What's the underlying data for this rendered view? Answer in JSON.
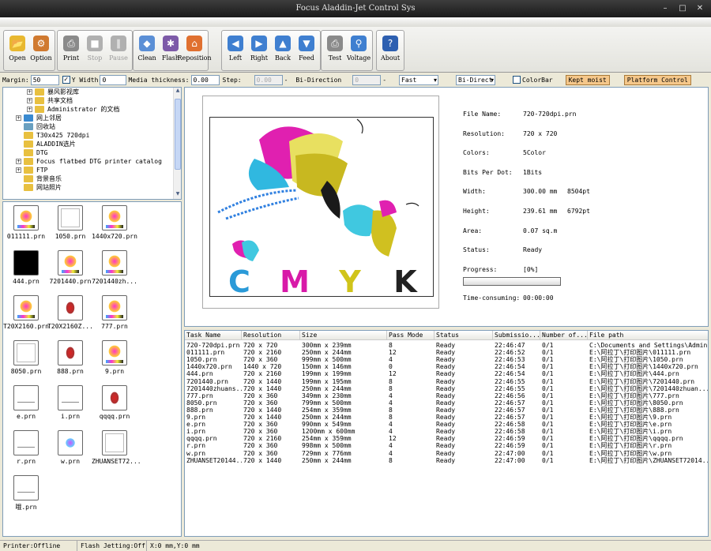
{
  "window": {
    "title": "Focus Aladdin-Jet Control Sys"
  },
  "toolbar": {
    "groups": [
      [
        {
          "label": "Open",
          "icon": "folder-open-icon",
          "color": "#e8b830",
          "glyph": "📂",
          "enabled": true
        },
        {
          "label": "Option",
          "icon": "option-gear-icon",
          "color": "#d07a30",
          "glyph": "⚙",
          "enabled": true
        }
      ],
      [
        {
          "label": "Print",
          "icon": "printer-icon",
          "color": "#8a8a8a",
          "glyph": "⎙",
          "enabled": true
        },
        {
          "label": "Stop",
          "icon": "stop-icon",
          "color": "#b0b0b0",
          "glyph": "■",
          "enabled": false
        },
        {
          "label": "Pause",
          "icon": "pause-icon",
          "color": "#b0b0b0",
          "glyph": "∥",
          "enabled": false
        }
      ],
      [
        {
          "label": "Clean",
          "icon": "clean-icon",
          "color": "#5b8fd6",
          "glyph": "◆",
          "enabled": true
        },
        {
          "label": "Flash",
          "icon": "flash-icon",
          "color": "#7d5aa8",
          "glyph": "✱",
          "enabled": true
        },
        {
          "label": "Reposition",
          "icon": "home-icon",
          "color": "#e07030",
          "glyph": "⌂",
          "enabled": true
        }
      ],
      [
        {
          "label": "Left",
          "icon": "arrow-left-icon",
          "color": "#3f7fd0",
          "glyph": "◀",
          "enabled": true
        },
        {
          "label": "Right",
          "icon": "arrow-right-icon",
          "color": "#3f7fd0",
          "glyph": "▶",
          "enabled": true
        },
        {
          "label": "Back",
          "icon": "arrow-up-icon",
          "color": "#3f7fd0",
          "glyph": "▲",
          "enabled": true
        },
        {
          "label": "Feed",
          "icon": "arrow-down-icon",
          "color": "#3f7fd0",
          "glyph": "▼",
          "enabled": true
        }
      ],
      [
        {
          "label": "Test",
          "icon": "test-print-icon",
          "color": "#8a8a8a",
          "glyph": "⎙",
          "enabled": true
        },
        {
          "label": "Voltage",
          "icon": "voltage-magnifier-icon",
          "color": "#3f7fd0",
          "glyph": "⚲",
          "enabled": true
        }
      ],
      [
        {
          "label": "About",
          "icon": "about-help-icon",
          "color": "#2d5fb0",
          "glyph": "?",
          "enabled": true
        }
      ]
    ]
  },
  "options": {
    "margin_label": "Margin:",
    "margin_value": "50",
    "ywidth_label": "Y Width",
    "ywidth_value": "0",
    "media_label": "Media thickness:",
    "media_value": "0.00",
    "step_label": "Step:",
    "step_value": "0.00",
    "step_suffix": "-",
    "bidir_label": "Bi-Direction",
    "bidir_value": "0",
    "bidir_suffix": "-",
    "speed_value": "Fast",
    "direct_value": "Bi-Direct",
    "colorbar_label": "ColorBar",
    "kept_label": "Kept moist",
    "platform_label": "Platform Control"
  },
  "tree": [
    {
      "label": "暴风影视库",
      "indent": 2,
      "pm": "+",
      "color": "#e8c040"
    },
    {
      "label": "共享文档",
      "indent": 2,
      "pm": "+",
      "color": "#e8c040"
    },
    {
      "label": "Administrator 的文档",
      "indent": 2,
      "pm": "+",
      "color": "#e8c040"
    },
    {
      "label": "网上邻居",
      "indent": 1,
      "pm": "+",
      "color": "#3a8ad0"
    },
    {
      "label": "回收站",
      "indent": 1,
      "pm": "",
      "color": "#6aa0c0"
    },
    {
      "label": "T30x425 720dpi",
      "indent": 1,
      "pm": "",
      "color": "#e8c040"
    },
    {
      "label": "ALADDIN选片",
      "indent": 1,
      "pm": "",
      "color": "#e8c040"
    },
    {
      "label": "DTG",
      "indent": 1,
      "pm": "",
      "color": "#e8c040"
    },
    {
      "label": "Focus flatbed DTG printer catalog",
      "indent": 1,
      "pm": "+",
      "color": "#e8c040"
    },
    {
      "label": "FTP",
      "indent": 1,
      "pm": "+",
      "color": "#e8c040"
    },
    {
      "label": "背景音乐",
      "indent": 1,
      "pm": "",
      "color": "#e8c040"
    },
    {
      "label": "网站照片",
      "indent": 1,
      "pm": "",
      "color": "#e8c040"
    }
  ],
  "thumbnails": [
    {
      "name": "011111.prn",
      "style": "pic"
    },
    {
      "name": "1050.prn",
      "style": "blank"
    },
    {
      "name": "1440x720.prn",
      "style": "pic"
    },
    {
      "name": "444.prn",
      "style": "black"
    },
    {
      "name": "7201440.prn",
      "style": "pic"
    },
    {
      "name": "7201440zh...",
      "style": "pic"
    },
    {
      "name": "T20X2160.prn",
      "style": "pic"
    },
    {
      "name": "T20X2160Z...",
      "style": "pic2"
    },
    {
      "name": "777.prn",
      "style": "pic"
    },
    {
      "name": "8050.prn",
      "style": "blank"
    },
    {
      "name": "888.prn",
      "style": "pic2"
    },
    {
      "name": "9.prn",
      "style": "pic"
    },
    {
      "name": "e.prn",
      "style": "line"
    },
    {
      "name": "i.prn",
      "style": "line"
    },
    {
      "name": "qqqq.prn",
      "style": "pic2"
    },
    {
      "name": "r.prn",
      "style": "line"
    },
    {
      "name": "w.prn",
      "style": "pic3"
    },
    {
      "name": "ZHUANSET72...",
      "style": "blank"
    },
    {
      "name": "哦.prn",
      "style": "line"
    }
  ],
  "preview": {
    "cmyk": [
      "C",
      "M",
      "Y",
      "K"
    ],
    "info": [
      {
        "k": "File Name:",
        "v": "720-720dpi.prn",
        "v2": ""
      },
      {
        "k": "Resolution:",
        "v": "720 x 720",
        "v2": ""
      },
      {
        "k": "Colors:",
        "v": "5Color",
        "v2": ""
      },
      {
        "k": "Bits Per Dot:",
        "v": "1Bits",
        "v2": ""
      },
      {
        "k": "Width:",
        "v": "300.00 mm",
        "v2": "8504pt"
      },
      {
        "k": "Height:",
        "v": "239.61 mm",
        "v2": "6792pt"
      },
      {
        "k": "Area:",
        "v": "0.07 sq.m",
        "v2": ""
      },
      {
        "k": "Status:",
        "v": "Ready",
        "v2": ""
      },
      {
        "k": "Progress:",
        "v": "[0%]",
        "v2": ""
      }
    ],
    "time_label": "Time-consuming:",
    "time_value": "00:00:00",
    "progress": 0
  },
  "task_table": {
    "headers": [
      "Task Name",
      "Resolution",
      "Size",
      "Pass Mode",
      "Status",
      "Submissio...",
      "Number of...",
      "File path"
    ],
    "rows": [
      [
        "720-720dpi.prn",
        "720 x 720",
        "300mm x 239mm",
        "8",
        "Ready",
        "22:46:47",
        "0/1",
        "C:\\Documents and Settings\\Admin..."
      ],
      [
        "011111.prn",
        "720 x 2160",
        "250mm x 244mm",
        "12",
        "Ready",
        "22:46:52",
        "0/1",
        "E:\\阿拉丁\\打印图片\\011111.prn"
      ],
      [
        "1050.prn",
        "720 x 360",
        "999mm x 500mm",
        "4",
        "Ready",
        "22:46:53",
        "0/1",
        "E:\\阿拉丁\\打印图片\\1050.prn"
      ],
      [
        "1440x720.prn",
        "1440 x 720",
        "150mm x 146mm",
        "0",
        "Ready",
        "22:46:54",
        "0/1",
        "E:\\阿拉丁\\打印图片\\1440x720.prn"
      ],
      [
        "444.prn",
        "720 x 2160",
        "199mm x 199mm",
        "12",
        "Ready",
        "22:46:54",
        "0/1",
        "E:\\阿拉丁\\打印图片\\444.prn"
      ],
      [
        "7201440.prn",
        "720 x 1440",
        "199mm x 195mm",
        "8",
        "Ready",
        "22:46:55",
        "0/1",
        "E:\\阿拉丁\\打印图片\\7201440.prn"
      ],
      [
        "7201440zhuans...",
        "720 x 1440",
        "250mm x 244mm",
        "8",
        "Ready",
        "22:46:55",
        "0/1",
        "E:\\阿拉丁\\打印图片\\7201440zhuan..."
      ],
      [
        "777.prn",
        "720 x 360",
        "349mm x 230mm",
        "4",
        "Ready",
        "22:46:56",
        "0/1",
        "E:\\阿拉丁\\打印图片\\777.prn"
      ],
      [
        "8050.prn",
        "720 x 360",
        "799mm x 500mm",
        "4",
        "Ready",
        "22:46:57",
        "0/1",
        "E:\\阿拉丁\\打印图片\\8050.prn"
      ],
      [
        "888.prn",
        "720 x 1440",
        "254mm x 359mm",
        "8",
        "Ready",
        "22:46:57",
        "0/1",
        "E:\\阿拉丁\\打印图片\\888.prn"
      ],
      [
        "9.prn",
        "720 x 1440",
        "250mm x 244mm",
        "8",
        "Ready",
        "22:46:57",
        "0/1",
        "E:\\阿拉丁\\打印图片\\9.prn"
      ],
      [
        "e.prn",
        "720 x 360",
        "990mm x 549mm",
        "4",
        "Ready",
        "22:46:58",
        "0/1",
        "E:\\阿拉丁\\打印图片\\e.prn"
      ],
      [
        "i.prn",
        "720 x 360",
        "1200mm x 600mm",
        "4",
        "Ready",
        "22:46:58",
        "0/1",
        "E:\\阿拉丁\\打印图片\\i.prn"
      ],
      [
        "qqqq.prn",
        "720 x 2160",
        "254mm x 359mm",
        "12",
        "Ready",
        "22:46:59",
        "0/1",
        "E:\\阿拉丁\\打印图片\\qqqq.prn"
      ],
      [
        "r.prn",
        "720 x 360",
        "998mm x 500mm",
        "4",
        "Ready",
        "22:46:59",
        "0/1",
        "E:\\阿拉丁\\打印图片\\r.prn"
      ],
      [
        "w.prn",
        "720 x 360",
        "729mm x 776mm",
        "4",
        "Ready",
        "22:47:00",
        "0/1",
        "E:\\阿拉丁\\打印图片\\w.prn"
      ],
      [
        "ZHUANSET20144...",
        "720 x 1440",
        "250mm x 244mm",
        "8",
        "Ready",
        "22:47:00",
        "0/1",
        "E:\\阿拉丁\\打印图片\\ZHUANSET72014..."
      ]
    ]
  },
  "statusbar": {
    "printer": "Printer:Offline",
    "flash": "Flash Jetting:Off",
    "coords": "X:0 mm,Y:0 mm"
  }
}
